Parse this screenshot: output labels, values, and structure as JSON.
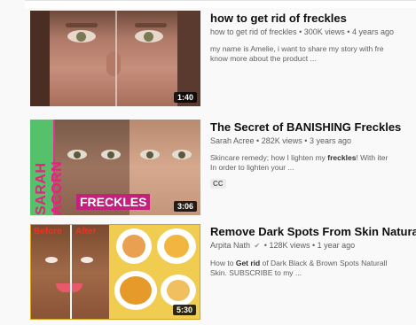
{
  "videos": [
    {
      "title": "how to get rid of freckles",
      "channel": "how to get rid of freckles",
      "views": "300K views",
      "age": "4 years ago",
      "description_line1": "my name is Amelie, i want to share my story with fre",
      "description_line2": "know more about the product ...",
      "duration": "1:40"
    },
    {
      "title": "The Secret of BANISHING Freckles",
      "channel": "Sarah Acree",
      "views": "282K views",
      "age": "3 years ago",
      "description_line1_pre": "Skincare remedy; how I lighten my ",
      "description_line1_bold": "freckles",
      "description_line1_post": "! With iter",
      "description_line2": "In order to lighten your ...",
      "badge": "CC",
      "thumb_banner_text": "SARAH ACORN",
      "thumb_label_text": "FRECKLES",
      "duration": "3:06"
    },
    {
      "title": "Remove Dark Spots From Skin Natura",
      "channel": "Arpita Nath",
      "verified_icon": "check-circle-icon",
      "views": "128K views",
      "age": "1 year ago",
      "description_line1_pre": "How to ",
      "description_line1_bold": "Get rid",
      "description_line1_post": " of Dark Black & Brown Spots Naturall",
      "description_line2": "Skin. SUBSCRIBE to my ...",
      "thumb_before": "Before",
      "thumb_after": "After",
      "duration": "5:30"
    }
  ],
  "separator": "•",
  "verified_glyph": "✔"
}
